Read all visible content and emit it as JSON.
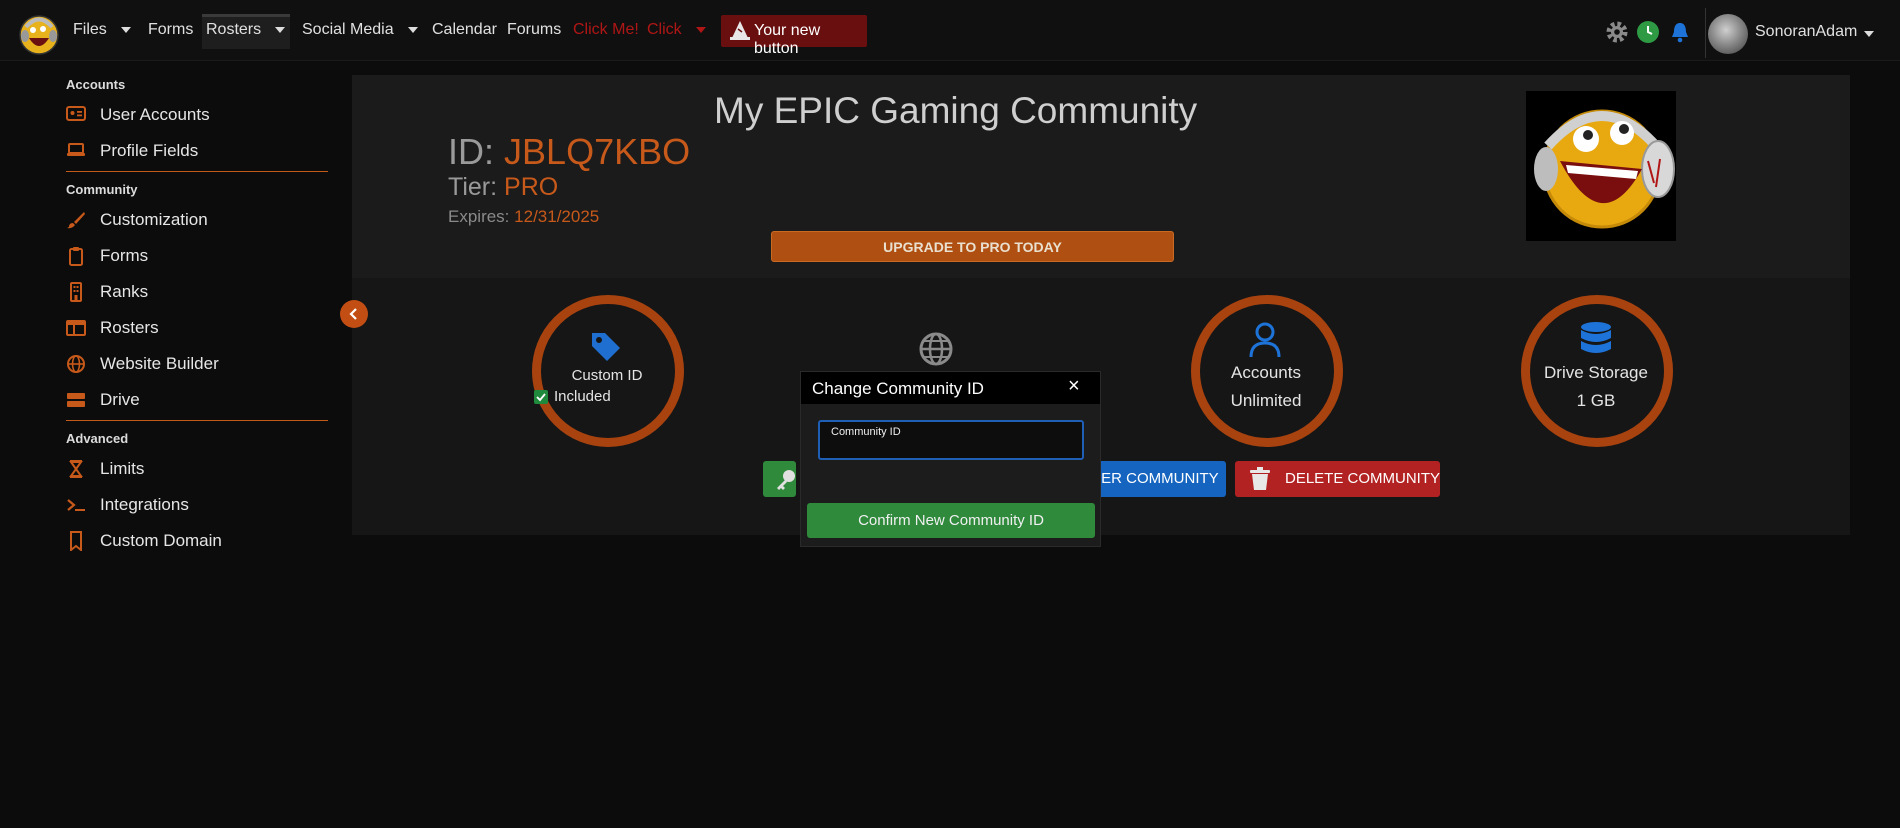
{
  "nav": {
    "items": [
      "Files",
      "Forms",
      "Rosters",
      "Social Media",
      "Calendar",
      "Forums"
    ],
    "red_items": [
      "Click Me!",
      "Click"
    ],
    "new_button": "Your new button",
    "username": "SonoranAdam"
  },
  "sidebar": {
    "sections": [
      {
        "heading": "Accounts",
        "items": [
          "User Accounts",
          "Profile Fields"
        ]
      },
      {
        "heading": "Community",
        "items": [
          "Customization",
          "Forms",
          "Ranks",
          "Rosters",
          "Website Builder",
          "Drive"
        ]
      },
      {
        "heading": "Advanced",
        "items": [
          "Limits",
          "Integrations",
          "Custom Domain"
        ]
      }
    ]
  },
  "community": {
    "name": "My EPIC Gaming Community",
    "id_label": "ID:",
    "id_value": "JBLQ7KBO",
    "tier_label": "Tier:",
    "tier_value": "PRO",
    "expires_label": "Expires:",
    "expires_value": "12/31/2025",
    "upgrade_label": "UPGRADE TO PRO TODAY"
  },
  "features": [
    {
      "title": "Custom ID",
      "value": "Included",
      "icon": "tag-icon"
    },
    {
      "title": "",
      "value": "",
      "icon": "globe-icon"
    },
    {
      "title": "Accounts",
      "value": "Unlimited",
      "icon": "user-icon"
    },
    {
      "title": "Drive Storage",
      "value": "1 GB",
      "icon": "database-icon"
    }
  ],
  "actions": {
    "transfer_label": "FER COMMUNITY",
    "delete_label": "DELETE COMMUNITY"
  },
  "modal": {
    "title": "Change Community ID",
    "close": "×",
    "field_label": "Community ID",
    "field_value": "",
    "confirm_label": "Confirm New Community ID"
  },
  "colors": {
    "accent": "#c7591a",
    "ring": "#a8430f",
    "confirm": "#2f8a3c",
    "delete": "#b32222",
    "transfer": "#1565c0",
    "focus": "#1e5fb5"
  }
}
